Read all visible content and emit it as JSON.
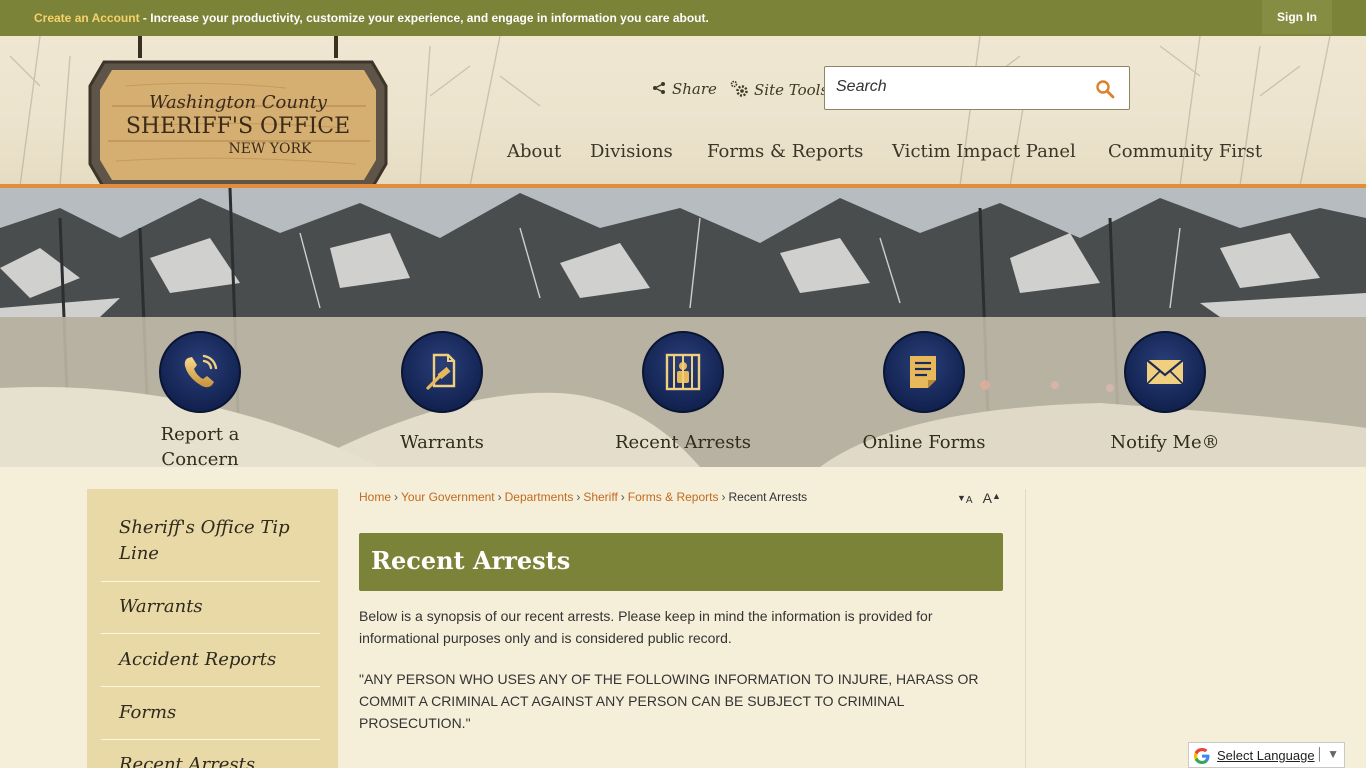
{
  "topbar": {
    "create_account": "Create an Account",
    "message": " - Increase your productivity, customize your experience, and engage in information you care about.",
    "sign_in": "Sign In"
  },
  "logo": {
    "line1": "Washington County",
    "line2": "SHERIFF'S OFFICE",
    "line3": "NEW YORK"
  },
  "header": {
    "share": "Share",
    "site_tools": "Site Tools",
    "search_placeholder": "Search"
  },
  "nav": {
    "items": [
      "About",
      "Divisions",
      "Forms & Reports",
      "Victim Impact Panel",
      "Community First"
    ]
  },
  "quick_links": [
    {
      "label1": "Report a",
      "label2": "Concern",
      "icon": "phone-icon"
    },
    {
      "label1": "Warrants",
      "label2": "",
      "icon": "document-gavel-icon"
    },
    {
      "label1": "Recent Arrests",
      "label2": "",
      "icon": "jail-icon"
    },
    {
      "label1": "Online Forms",
      "label2": "",
      "icon": "forms-icon"
    },
    {
      "label1": "Notify Me®",
      "label2": "",
      "icon": "envelope-icon"
    }
  ],
  "sidebar": {
    "items": [
      "Sheriff's Office Tip Line",
      "Warrants",
      "Accident Reports",
      "Forms",
      "Recent Arrests"
    ]
  },
  "breadcrumb": {
    "items": [
      "Home",
      "Your Government",
      "Departments",
      "Sheriff",
      "Forms & Reports"
    ],
    "current": "Recent Arrests"
  },
  "font_controls": {
    "decrease": "A",
    "increase": "A"
  },
  "page": {
    "title": "Recent Arrests",
    "intro": "Below is a synopsis of our recent arrests. Please keep in mind the information is provided for informational purposes only and is considered public record.",
    "warning": "\"ANY PERSON WHO USES ANY OF THE FOLLOWING INFORMATION TO INJURE, HARASS OR COMMIT A CRIMINAL ACT AGAINST ANY PERSON CAN BE SUBJECT TO CRIMINAL PROSECUTION.\""
  },
  "translate": {
    "label": "Select Language"
  },
  "colors": {
    "olive": "#7b8338",
    "orange_accent": "#e28d3c",
    "link": "#c26a1f",
    "navy": "#142555"
  }
}
